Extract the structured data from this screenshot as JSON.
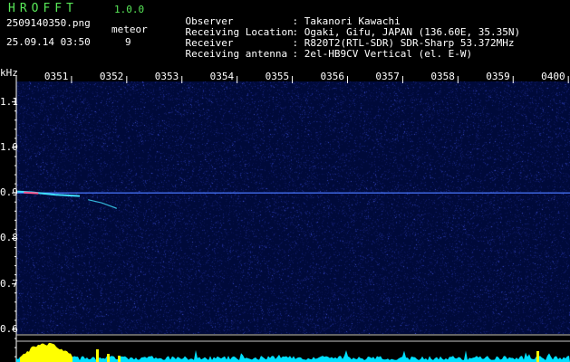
{
  "app": {
    "name": "HROFFT",
    "version": "1.0.0",
    "filename": "2509140350.png",
    "datetime": "25.09.14 03:50",
    "counter_label": "meteor",
    "counter_value": "9"
  },
  "station_info": [
    {
      "label": "Observer",
      "value": ": Takanori Kawachi"
    },
    {
      "label": "Receiving Location",
      "value": ": Ogaki, Gifu, JAPAN (136.60E, 35.35N)"
    },
    {
      "label": "Receiver",
      "value": ": R820T2(RTL-SDR) SDR-Sharp 53.372MHz"
    },
    {
      "label": "Receiving antenna",
      "value": ": 2el-HB9CV Vertical (el. E-W)"
    }
  ],
  "colors": {
    "background": "#000000",
    "plot_background": "#000a3a",
    "app_title": "#58e858",
    "carrier_line": "#4a78ff",
    "meteor_trace": "#40e0ff",
    "meteor_head": "#ff5a90",
    "level_fill": "#00e0ff",
    "level_peak": "#ffff00",
    "scale_marks": "#ffffff"
  },
  "chart_data": {
    "type": "heatmap",
    "ylabel": "kHz",
    "y_ticks": [
      "1.1",
      "1.0",
      "0.9",
      "0.8",
      "0.7",
      "0.6"
    ],
    "y_tick_values": [
      1.1,
      1.0,
      0.9,
      0.8,
      0.7,
      0.6
    ],
    "ylim": [
      0.59,
      1.145
    ],
    "x_ticks": [
      "0351",
      "0352",
      "0353",
      "0354",
      "0355",
      "0356",
      "0357",
      "0358",
      "0359",
      "0400"
    ],
    "x_tick_values": [
      1,
      2,
      3,
      4,
      5,
      6,
      7,
      8,
      9,
      10
    ],
    "xlim": [
      0,
      10.03
    ],
    "carrier_khz": 0.9,
    "meteor_trace": {
      "points": [
        [
          0.02,
          0.903
        ],
        [
          0.3,
          0.901
        ],
        [
          0.7,
          0.896
        ],
        [
          1.15,
          0.893
        ]
      ],
      "tail": [
        [
          1.3,
          0.885
        ],
        [
          1.55,
          0.878
        ],
        [
          1.82,
          0.866
        ]
      ]
    }
  }
}
